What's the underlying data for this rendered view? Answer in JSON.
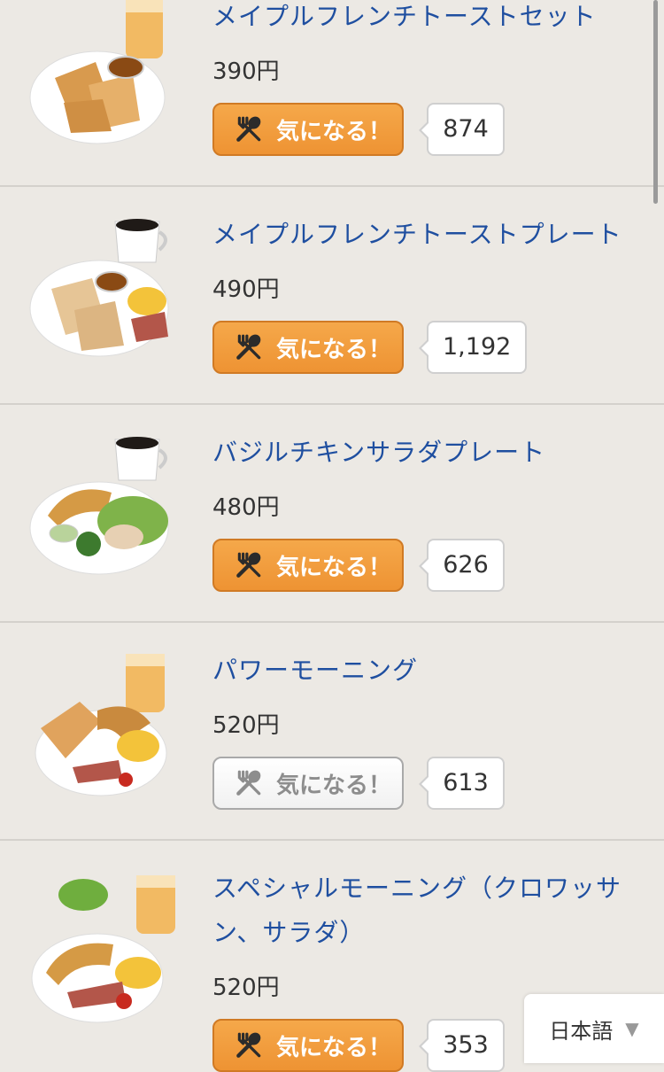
{
  "menu": {
    "items": [
      {
        "name": "メイプルフレンチトーストセット",
        "price": "390円",
        "button_label": "気になる！",
        "active": true,
        "count": "874"
      },
      {
        "name": "メイプルフレンチトーストプレート",
        "price": "490円",
        "button_label": "気になる！",
        "active": true,
        "count": "1,192"
      },
      {
        "name": "バジルチキンサラダプレート",
        "price": "480円",
        "button_label": "気になる！",
        "active": true,
        "count": "626"
      },
      {
        "name": "パワーモーニング",
        "price": "520円",
        "button_label": "気になる！",
        "active": false,
        "count": "613"
      },
      {
        "name": "スペシャルモーニング（クロワッサン、サラダ）",
        "price": "520円",
        "button_label": "気になる！",
        "active": true,
        "count": "353"
      }
    ]
  },
  "language_selector": {
    "label": "日本語",
    "icon": "triangle-down-icon"
  },
  "colors": {
    "accent": "#ee9333",
    "link": "#1f4fa0",
    "background": "#ece9e4"
  }
}
